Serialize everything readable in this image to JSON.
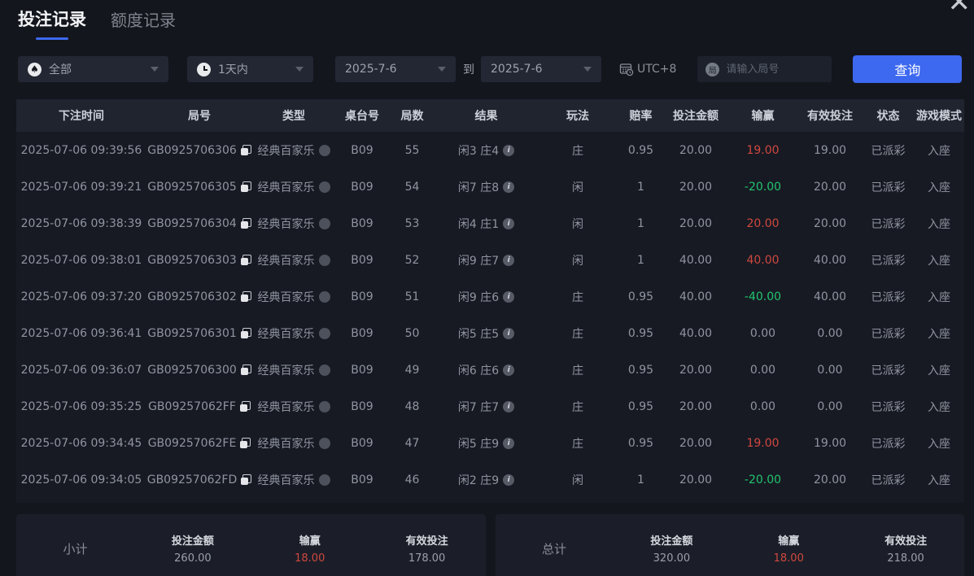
{
  "colors": {
    "bg": "#14161d",
    "table_bg": "#171a23",
    "header_bg": "#20242f",
    "control_bg": "#232734",
    "input_bg": "#1d212c",
    "accent": "#3d68f0",
    "red": "#d0483f",
    "green": "#22c36e"
  },
  "tabs": [
    {
      "label": "投注记录",
      "active": true
    },
    {
      "label": "额度记录",
      "active": false
    }
  ],
  "close_glyph": "✕",
  "filters": {
    "game_type": {
      "value": "全部",
      "icon": "spade"
    },
    "time_range": {
      "value": "1天内",
      "icon": "clock"
    },
    "date_from": "2025-7-6",
    "to_label": "到",
    "date_to": "2025-7-6",
    "timezone": "UTC+8",
    "round_icon_char": "局",
    "round_input_placeholder": "请输入局号",
    "search_button": "查询"
  },
  "table": {
    "columns": [
      "下注时间",
      "局号",
      "类型",
      "桌台号",
      "局数",
      "结果",
      "玩法",
      "赔率",
      "投注金额",
      "输赢",
      "有效投注",
      "状态",
      "游戏模式"
    ],
    "rows": [
      {
        "time": "2025-07-06 09:39:56",
        "round_id": "GB0925706306",
        "type": "经典百家乐",
        "table_no": "B09",
        "round_no": "55",
        "result": "闲3 庄4",
        "play": "庄",
        "odds": "0.95",
        "bet": "20.00",
        "win_loss": "19.00",
        "win_loss_color": "red",
        "valid_bet": "19.00",
        "status": "已派彩",
        "mode": "入座"
      },
      {
        "time": "2025-07-06 09:39:21",
        "round_id": "GB0925706305",
        "type": "经典百家乐",
        "table_no": "B09",
        "round_no": "54",
        "result": "闲7 庄8",
        "play": "闲",
        "odds": "1",
        "bet": "20.00",
        "win_loss": "-20.00",
        "win_loss_color": "green",
        "valid_bet": "20.00",
        "status": "已派彩",
        "mode": "入座"
      },
      {
        "time": "2025-07-06 09:38:39",
        "round_id": "GB0925706304",
        "type": "经典百家乐",
        "table_no": "B09",
        "round_no": "53",
        "result": "闲4 庄1",
        "play": "闲",
        "odds": "1",
        "bet": "20.00",
        "win_loss": "20.00",
        "win_loss_color": "red",
        "valid_bet": "20.00",
        "status": "已派彩",
        "mode": "入座"
      },
      {
        "time": "2025-07-06 09:38:01",
        "round_id": "GB0925706303",
        "type": "经典百家乐",
        "table_no": "B09",
        "round_no": "52",
        "result": "闲9 庄7",
        "play": "闲",
        "odds": "1",
        "bet": "40.00",
        "win_loss": "40.00",
        "win_loss_color": "red",
        "valid_bet": "40.00",
        "status": "已派彩",
        "mode": "入座"
      },
      {
        "time": "2025-07-06 09:37:20",
        "round_id": "GB0925706302",
        "type": "经典百家乐",
        "table_no": "B09",
        "round_no": "51",
        "result": "闲9 庄6",
        "play": "庄",
        "odds": "0.95",
        "bet": "40.00",
        "win_loss": "-40.00",
        "win_loss_color": "green",
        "valid_bet": "40.00",
        "status": "已派彩",
        "mode": "入座"
      },
      {
        "time": "2025-07-06 09:36:41",
        "round_id": "GB0925706301",
        "type": "经典百家乐",
        "table_no": "B09",
        "round_no": "50",
        "result": "闲5 庄5",
        "play": "庄",
        "odds": "0.95",
        "bet": "40.00",
        "win_loss": "0.00",
        "win_loss_color": "none",
        "valid_bet": "0.00",
        "status": "已派彩",
        "mode": "入座"
      },
      {
        "time": "2025-07-06 09:36:07",
        "round_id": "GB0925706300",
        "type": "经典百家乐",
        "table_no": "B09",
        "round_no": "49",
        "result": "闲6 庄6",
        "play": "庄",
        "odds": "0.95",
        "bet": "20.00",
        "win_loss": "0.00",
        "win_loss_color": "none",
        "valid_bet": "0.00",
        "status": "已派彩",
        "mode": "入座"
      },
      {
        "time": "2025-07-06 09:35:25",
        "round_id": "GB09257062FF",
        "type": "经典百家乐",
        "table_no": "B09",
        "round_no": "48",
        "result": "闲7 庄7",
        "play": "庄",
        "odds": "0.95",
        "bet": "20.00",
        "win_loss": "0.00",
        "win_loss_color": "none",
        "valid_bet": "0.00",
        "status": "已派彩",
        "mode": "入座"
      },
      {
        "time": "2025-07-06 09:34:45",
        "round_id": "GB09257062FE",
        "type": "经典百家乐",
        "table_no": "B09",
        "round_no": "47",
        "result": "闲5 庄9",
        "play": "庄",
        "odds": "0.95",
        "bet": "20.00",
        "win_loss": "19.00",
        "win_loss_color": "red",
        "valid_bet": "19.00",
        "status": "已派彩",
        "mode": "入座"
      },
      {
        "time": "2025-07-06 09:34:05",
        "round_id": "GB09257062FD",
        "type": "经典百家乐",
        "table_no": "B09",
        "round_no": "46",
        "result": "闲2 庄9",
        "play": "闲",
        "odds": "1",
        "bet": "20.00",
        "win_loss": "-20.00",
        "win_loss_color": "green",
        "valid_bet": "20.00",
        "status": "已派彩",
        "mode": "入座"
      }
    ]
  },
  "summary": {
    "subtotal": {
      "label": "小计",
      "bet_label": "投注金额",
      "bet": "260.00",
      "win_label": "输赢",
      "win": "18.00",
      "valid_label": "有效投注",
      "valid": "178.00"
    },
    "total": {
      "label": "总计",
      "bet_label": "投注金额",
      "bet": "320.00",
      "win_label": "输赢",
      "win": "18.00",
      "valid_label": "有效投注",
      "valid": "218.00"
    }
  }
}
